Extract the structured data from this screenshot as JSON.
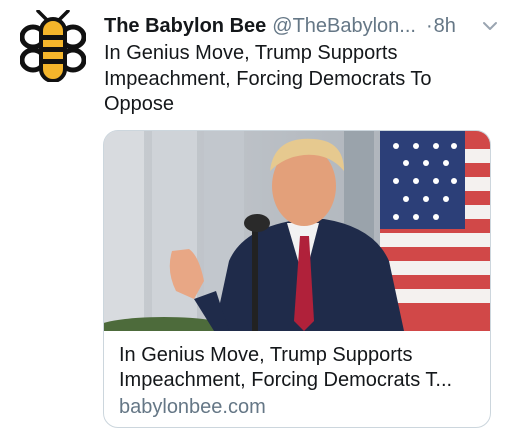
{
  "tweet": {
    "author_name": "The Babylon Bee",
    "author_handle": "@TheBabylon...",
    "separator": "·",
    "time": "8h",
    "text": "In Genius Move, Trump Supports Impeachment, Forcing Democrats To Oppose",
    "avatar_icon": "bee-logo-icon",
    "caret_icon": "chevron-down-icon"
  },
  "card": {
    "title": "In Genius Move, Trump Supports Impeachment, Forcing Democrats T...",
    "domain": "babylonbee.com"
  },
  "colors": {
    "logo_black": "#111111",
    "logo_yellow": "#f4b52b",
    "secondary_text": "#657786",
    "border": "#ccd6dd"
  }
}
